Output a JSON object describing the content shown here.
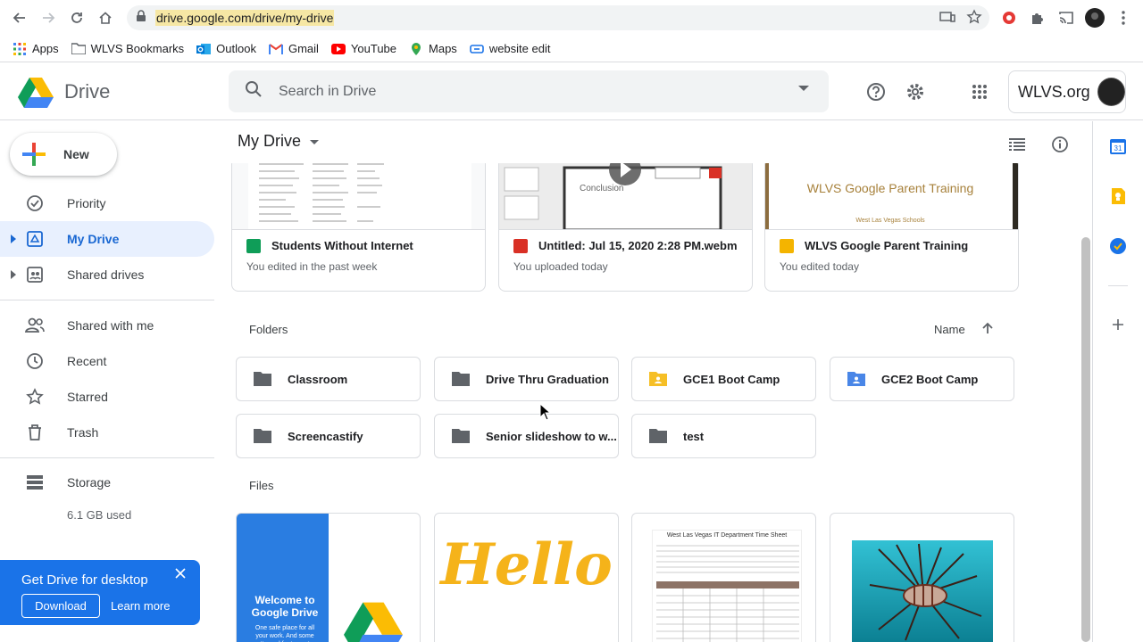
{
  "browser": {
    "url": "drive.google.com/drive/my-drive",
    "bookmarks": [
      {
        "label": "Apps",
        "icon": "apps-grid-icon",
        "color": "#4285f4"
      },
      {
        "label": "WLVS Bookmarks",
        "icon": "folder-icon",
        "color": "#5f6368"
      },
      {
        "label": "Outlook",
        "icon": "outlook-icon",
        "color": "#0078d4"
      },
      {
        "label": "Gmail",
        "icon": "gmail-icon",
        "color": "#ea4335"
      },
      {
        "label": "YouTube",
        "icon": "youtube-icon",
        "color": "#ff0000"
      },
      {
        "label": "Maps",
        "icon": "maps-icon",
        "color": "#34a853"
      },
      {
        "label": "website edit",
        "icon": "link-icon",
        "color": "#1a73e8"
      }
    ]
  },
  "header": {
    "app_name": "Drive",
    "search_placeholder": "Search in Drive",
    "account_org": "WLVS.org"
  },
  "sidebar": {
    "new_label": "New",
    "items": [
      {
        "label": "Priority",
        "icon": "priority-check-icon",
        "active": false
      },
      {
        "label": "My Drive",
        "icon": "my-drive-icon",
        "active": true
      },
      {
        "label": "Shared drives",
        "icon": "shared-drives-icon",
        "active": false
      },
      {
        "label": "Shared with me",
        "icon": "shared-with-me-icon",
        "active": false
      },
      {
        "label": "Recent",
        "icon": "clock-icon",
        "active": false
      },
      {
        "label": "Starred",
        "icon": "star-icon",
        "active": false
      },
      {
        "label": "Trash",
        "icon": "trash-icon",
        "active": false
      }
    ],
    "storage_label": "Storage",
    "storage_used": "6.1 GB used"
  },
  "banner": {
    "title": "Get Drive for desktop",
    "download": "Download",
    "learn_more": "Learn more"
  },
  "main": {
    "title": "My Drive",
    "quick_access": [
      {
        "name": "Students Without Internet",
        "sub": "You edited in the past week",
        "type": "sheets",
        "color": "#0f9d58"
      },
      {
        "name": "Untitled: Jul 15, 2020 2:28 PM.webm",
        "sub": "You uploaded today",
        "type": "video",
        "color": "#d93025"
      },
      {
        "name": "WLVS Google Parent Training",
        "sub": "You edited today",
        "type": "slides",
        "color": "#f4b400"
      }
    ],
    "slide_thumb_title": "WLVS Google Parent Training",
    "slide_thumb_sub": "West Las Vegas Schools",
    "video_thumb_title": "Conclusion",
    "folders_label": "Folders",
    "sort_label": "Name",
    "folders": [
      {
        "name": "Classroom",
        "color": "#5f6368"
      },
      {
        "name": "Drive Thru Graduation",
        "color": "#5f6368"
      },
      {
        "name": "GCE1 Boot Camp",
        "color": "#f6bf26"
      },
      {
        "name": "GCE2 Boot Camp",
        "color": "#4986e7"
      },
      {
        "name": "Screencastify",
        "color": "#5f6368"
      },
      {
        "name": "Senior slideshow to w...",
        "color": "#5f6368"
      },
      {
        "name": "test",
        "color": "#5f6368"
      }
    ],
    "files_label": "Files",
    "welcome_title": "Welcome to Google Drive",
    "welcome_sub": "One safe place for all your work. And some pretty cool features, too.",
    "hello_text": "Hello",
    "timesheet_title": "West Las Vegas IT Department Time Sheet"
  }
}
